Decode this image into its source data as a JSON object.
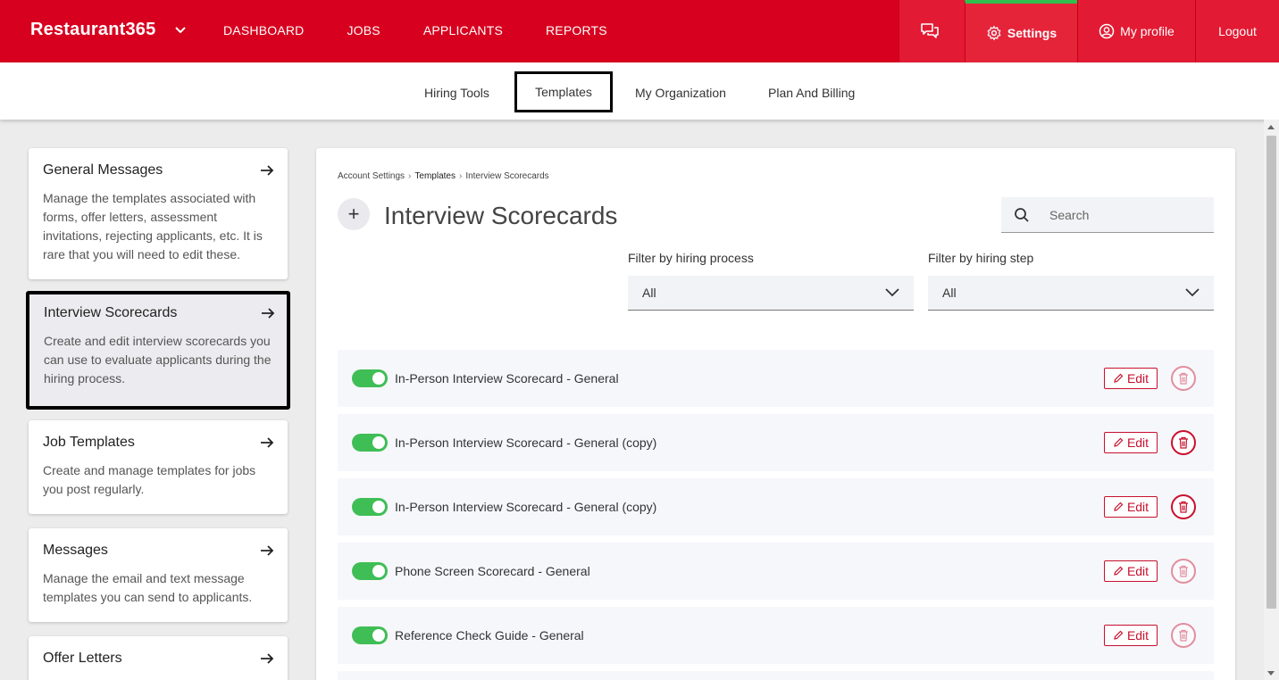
{
  "app": {
    "brand": "Restaurant365",
    "nav": [
      "DASHBOARD",
      "JOBS",
      "APPLICANTS",
      "REPORTS"
    ],
    "right": {
      "settings": "Settings",
      "profile": "My profile",
      "logout": "Logout"
    }
  },
  "subnav": {
    "tabs": [
      "Hiring Tools",
      "Templates",
      "My Organization",
      "Plan And Billing"
    ],
    "active": "Templates"
  },
  "sidebar": {
    "items": [
      {
        "title": "General Messages",
        "desc": "Manage the templates associated with forms, offer letters, assessment invitations, rejecting applicants, etc. It is rare that you will need to edit these."
      },
      {
        "title": "Interview Scorecards",
        "desc": "Create and edit interview scorecards you can use to evaluate applicants during the hiring process."
      },
      {
        "title": "Job Templates",
        "desc": "Create and manage templates for jobs you post regularly."
      },
      {
        "title": "Messages",
        "desc": "Manage the email and text message templates you can send to applicants."
      },
      {
        "title": "Offer Letters",
        "desc": ""
      }
    ]
  },
  "main": {
    "breadcrumb": [
      "Account Settings",
      "Templates",
      "Interview Scorecards"
    ],
    "title": "Interview Scorecards",
    "search_placeholder": "Search",
    "filters": {
      "process_label": "Filter by hiring process",
      "process_value": "All",
      "step_label": "Filter by hiring step",
      "step_value": "All"
    },
    "edit_label": "Edit",
    "rows": [
      {
        "name": "In-Person Interview Scorecard - General",
        "enabled": true
      },
      {
        "name": "In-Person Interview Scorecard - General (copy)",
        "enabled": true
      },
      {
        "name": "In-Person Interview Scorecard - General (copy)",
        "enabled": true
      },
      {
        "name": "Phone Screen Scorecard - General",
        "enabled": true
      },
      {
        "name": "Reference Check Guide - General",
        "enabled": true
      }
    ]
  },
  "colors": {
    "brand": "#d7001f",
    "active_indicator": "#2fc04e",
    "toggle_on": "#3fbe56"
  }
}
